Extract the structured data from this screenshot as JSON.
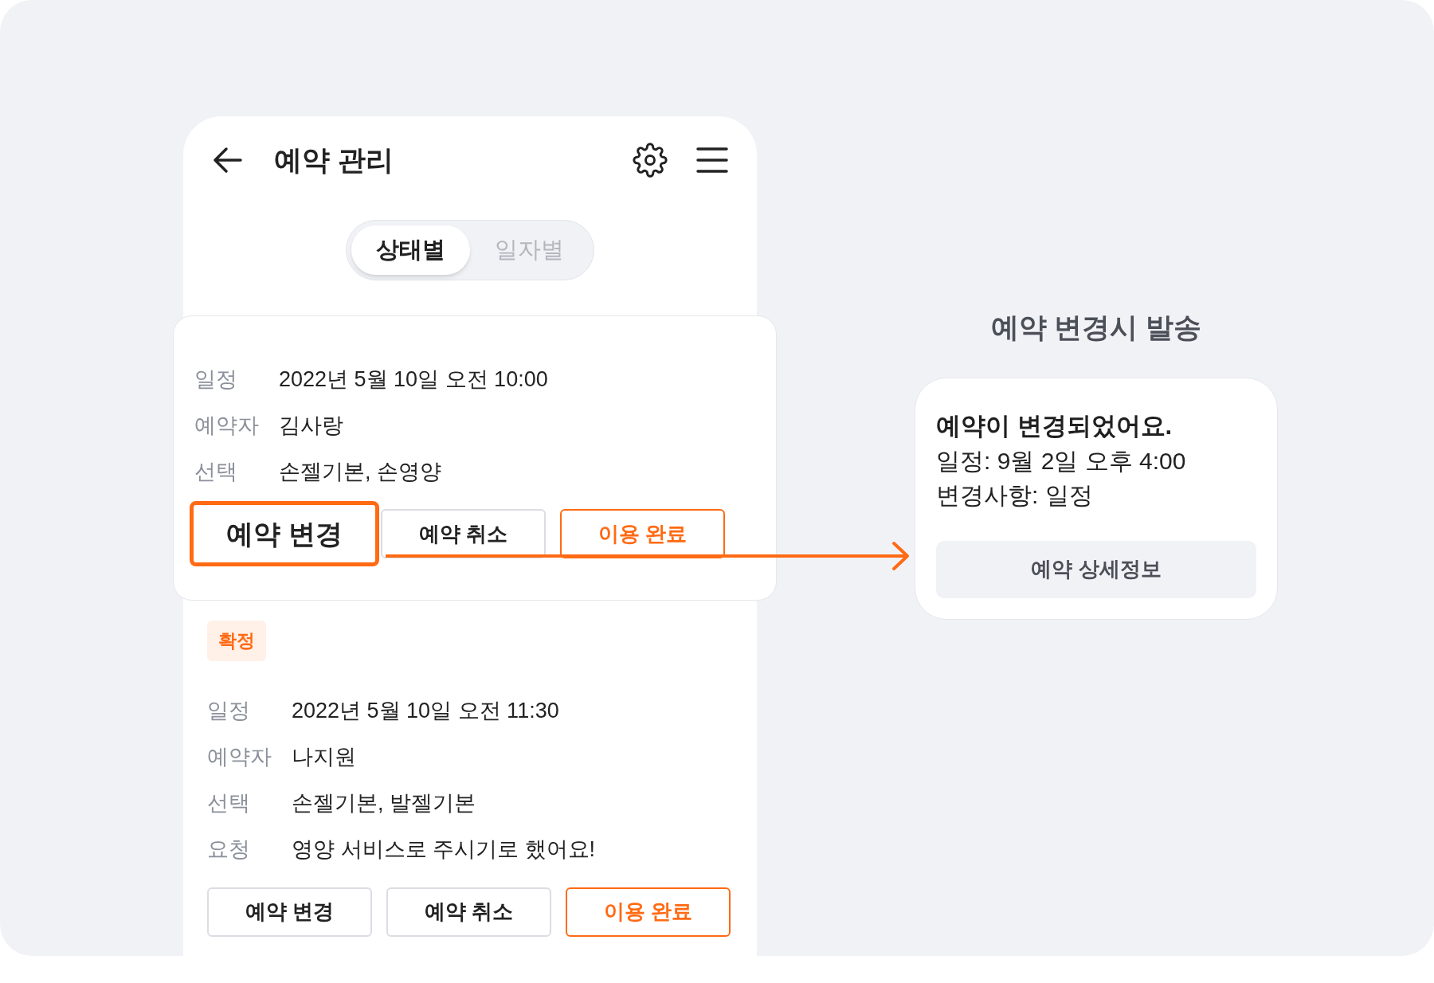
{
  "app_bar": {
    "title": "예약 관리"
  },
  "view_toggle": [
    {
      "label": "상태별",
      "selected": true
    },
    {
      "label": "일자별",
      "selected": false
    }
  ],
  "reservations": [
    {
      "highlighted": true,
      "fields": [
        {
          "label": "일정",
          "value": "2022년 5월 10일 오전 10:00"
        },
        {
          "label": "예약자",
          "value": "김사랑"
        },
        {
          "label": "선택",
          "value": "손젤기본, 손영양"
        }
      ],
      "actions": [
        {
          "label": "예약 변경",
          "kind": "outline",
          "emphasized": true
        },
        {
          "label": "예약 취소",
          "kind": "outline",
          "emphasized": false
        },
        {
          "label": "이용 완료",
          "kind": "accent",
          "emphasized": false
        }
      ]
    },
    {
      "highlighted": false,
      "status": "확정",
      "fields": [
        {
          "label": "일정",
          "value": "2022년 5월 10일 오전 11:30"
        },
        {
          "label": "예약자",
          "value": "나지원"
        },
        {
          "label": "선택",
          "value": "손젤기본, 발젤기본"
        },
        {
          "label": "요청",
          "value": "영양 서비스로 주시기로 했어요!"
        }
      ],
      "actions": [
        {
          "label": "예약 변경",
          "kind": "outline",
          "emphasized": false
        },
        {
          "label": "예약 취소",
          "kind": "outline",
          "emphasized": false
        },
        {
          "label": "이용 완료",
          "kind": "accent",
          "emphasized": false
        }
      ]
    }
  ],
  "callout": {
    "title": "예약 변경시 발송",
    "message": {
      "heading": "예약이 변경되었어요.",
      "lines": [
        "일정: 9월 2일 오후 4:00",
        "변경사항: 일정"
      ],
      "button": "예약 상세정보"
    }
  }
}
